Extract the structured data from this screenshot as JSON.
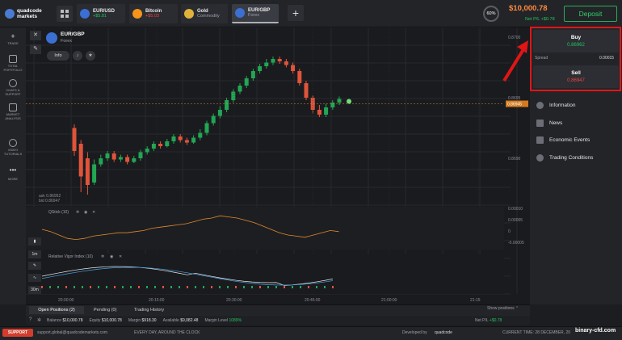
{
  "header": {
    "logo_line1": "quadcode",
    "logo_line2": "markets",
    "tabs": [
      {
        "name": "EUR/USD",
        "sub": "+$5.81",
        "sub_color": "#22c55e",
        "icon_color": "#3b6fd1"
      },
      {
        "name": "Bitcoin",
        "sub": "+$5.03",
        "sub_color": "#f04444",
        "icon_color": "#f7931a"
      },
      {
        "name": "Gold",
        "sub": "Commodity",
        "sub_color": "#9da1aa",
        "icon_color": "#e0b23a"
      },
      {
        "name": "EUR/GBP",
        "sub": "Forex",
        "sub_color": "#9da1aa",
        "icon_color": "#3b6fd1"
      }
    ],
    "add_tab": "+",
    "avatar_text": "60%",
    "balance": "$10,000.78",
    "net_pl": "Net P/L +$0.78",
    "deposit": "Deposit"
  },
  "sidebar": {
    "items": [
      {
        "label": "TRADE"
      },
      {
        "label": "TOTAL PORTFOLIO"
      },
      {
        "label": "CHATS & SUPPORT"
      },
      {
        "label": "MARKET ANALYSIS"
      },
      {
        "label": "VIDEO TUTORIALS"
      },
      {
        "label": "MORE"
      }
    ]
  },
  "asset": {
    "name": "EUR/GBP",
    "type": "Forex",
    "info": "Info"
  },
  "chart": {
    "price_levels": [
      "0.8700",
      "0.8695",
      "0.8690"
    ],
    "current_price": "0.86945",
    "time_ticks": [
      "20:00:00",
      "20:15:00",
      "20:30:00",
      "20:45:00",
      "21:00:00",
      "21:15"
    ],
    "ask_bid_lines": [
      "ask 0.86952",
      "bid 0.86947"
    ],
    "indicator1": {
      "name": "QStick (10)",
      "scale": [
        "0.00010",
        "0.00005",
        "0",
        "-0.00005"
      ]
    },
    "indicator2": {
      "name": "Relative Vigor Index (10)"
    },
    "timeframes": [
      "1m",
      "30m"
    ],
    "candles": [
      {
        "o": 0.86925,
        "c": 0.86906,
        "h": 0.86928,
        "l": 0.86902
      },
      {
        "o": 0.86912,
        "c": 0.86885,
        "h": 0.86915,
        "l": 0.86872
      },
      {
        "o": 0.869,
        "c": 0.86878,
        "h": 0.86905,
        "l": 0.8687
      },
      {
        "o": 0.8688,
        "c": 0.86895,
        "h": 0.86899,
        "l": 0.86878
      },
      {
        "o": 0.86895,
        "c": 0.869,
        "h": 0.86903,
        "l": 0.86893
      },
      {
        "o": 0.869,
        "c": 0.86904,
        "h": 0.86906,
        "l": 0.86898
      },
      {
        "o": 0.86904,
        "c": 0.86899,
        "h": 0.86906,
        "l": 0.86897
      },
      {
        "o": 0.86899,
        "c": 0.86901,
        "h": 0.86903,
        "l": 0.86897
      },
      {
        "o": 0.86901,
        "c": 0.86897,
        "h": 0.86903,
        "l": 0.86895
      },
      {
        "o": 0.86897,
        "c": 0.869,
        "h": 0.86902,
        "l": 0.86896
      },
      {
        "o": 0.869,
        "c": 0.86905,
        "h": 0.86907,
        "l": 0.86898
      },
      {
        "o": 0.86905,
        "c": 0.86908,
        "h": 0.8691,
        "l": 0.86903
      },
      {
        "o": 0.86908,
        "c": 0.86912,
        "h": 0.86914,
        "l": 0.86906
      },
      {
        "o": 0.86912,
        "c": 0.8691,
        "h": 0.86914,
        "l": 0.86908
      },
      {
        "o": 0.8691,
        "c": 0.86914,
        "h": 0.86916,
        "l": 0.86909
      },
      {
        "o": 0.86914,
        "c": 0.86918,
        "h": 0.8692,
        "l": 0.86912
      },
      {
        "o": 0.86918,
        "c": 0.86915,
        "h": 0.8692,
        "l": 0.86913
      },
      {
        "o": 0.86915,
        "c": 0.86913,
        "h": 0.86917,
        "l": 0.86911
      },
      {
        "o": 0.86913,
        "c": 0.86917,
        "h": 0.86919,
        "l": 0.86912
      },
      {
        "o": 0.86917,
        "c": 0.86921,
        "h": 0.86924,
        "l": 0.86915
      },
      {
        "o": 0.86921,
        "c": 0.86929,
        "h": 0.86931,
        "l": 0.86919
      },
      {
        "o": 0.86929,
        "c": 0.86935,
        "h": 0.86937,
        "l": 0.86927
      },
      {
        "o": 0.86935,
        "c": 0.8694,
        "h": 0.86943,
        "l": 0.86933
      },
      {
        "o": 0.8694,
        "c": 0.86948,
        "h": 0.8695,
        "l": 0.86938
      },
      {
        "o": 0.86948,
        "c": 0.86955,
        "h": 0.86957,
        "l": 0.86946
      },
      {
        "o": 0.86955,
        "c": 0.8696,
        "h": 0.86962,
        "l": 0.86953
      },
      {
        "o": 0.8696,
        "c": 0.86966,
        "h": 0.86968,
        "l": 0.86958
      },
      {
        "o": 0.86966,
        "c": 0.86972,
        "h": 0.86974,
        "l": 0.86964
      },
      {
        "o": 0.86972,
        "c": 0.86976,
        "h": 0.86978,
        "l": 0.8697
      },
      {
        "o": 0.86976,
        "c": 0.86979,
        "h": 0.86982,
        "l": 0.86974
      },
      {
        "o": 0.86979,
        "c": 0.86982,
        "h": 0.86984,
        "l": 0.86977
      },
      {
        "o": 0.86982,
        "c": 0.8698,
        "h": 0.86984,
        "l": 0.86978
      },
      {
        "o": 0.8698,
        "c": 0.86977,
        "h": 0.86982,
        "l": 0.86975
      },
      {
        "o": 0.86977,
        "c": 0.86972,
        "h": 0.86979,
        "l": 0.8697
      },
      {
        "o": 0.86972,
        "c": 0.86962,
        "h": 0.86974,
        "l": 0.8696
      },
      {
        "o": 0.86962,
        "c": 0.8695,
        "h": 0.86964,
        "l": 0.86948
      },
      {
        "o": 0.8695,
        "c": 0.8694,
        "h": 0.86952,
        "l": 0.86937
      },
      {
        "o": 0.8694,
        "c": 0.86936,
        "h": 0.86944,
        "l": 0.86934
      },
      {
        "o": 0.86936,
        "c": 0.86942,
        "h": 0.86945,
        "l": 0.86934
      },
      {
        "o": 0.86942,
        "c": 0.86946,
        "h": 0.86948,
        "l": 0.8694
      },
      {
        "o": 0.86946,
        "c": 0.86949,
        "h": 0.86951,
        "l": 0.86944
      }
    ]
  },
  "trade_panel": {
    "buy_label": "Buy",
    "buy_price": "0.86962",
    "spread_label": "Spread",
    "spread_value": "0.00015",
    "sell_label": "Sell",
    "sell_price": "0.86947",
    "buy_color": "#22c55e",
    "sell_color": "#f04444",
    "menu": [
      {
        "label": "Information",
        "icon": "info-icon"
      },
      {
        "label": "News",
        "icon": "news-icon"
      },
      {
        "label": "Economic Events",
        "icon": "calendar-icon"
      },
      {
        "label": "Trading Conditions",
        "icon": "conditions-icon"
      }
    ]
  },
  "positions": {
    "tabs": [
      "Open Positions (2)",
      "Pending (0)",
      "Trading History"
    ],
    "show_positions": "Show positions",
    "balance_label": "Balance",
    "balance": "$10,000.78",
    "equity_label": "Equity",
    "equity": "$10,000.78",
    "margin_label": "Margin",
    "margin": "$918.30",
    "available_label": "Available",
    "available": "$9,082.48",
    "margin_level_label": "Margin Level",
    "margin_level": "1089%",
    "net_pl_label": "Net P/L",
    "net_pl": "+$0.78"
  },
  "footer": {
    "support": "SUPPORT",
    "email": "support.global@quadcodemarkets.com",
    "slogan": "EVERY DAY, AROUND THE CLOCK",
    "developed_by": "Developed by",
    "developer": "quadcode",
    "current_time": "CURRENT TIME: 28 DECEMBER, 20",
    "watermark": "binary-cfd.com"
  }
}
